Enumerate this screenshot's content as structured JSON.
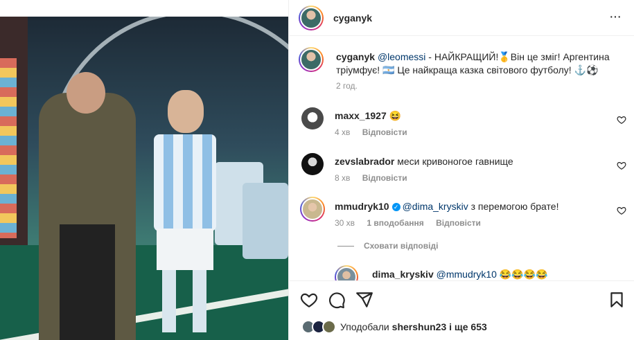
{
  "post": {
    "username": "cyganyk",
    "caption_user": "cyganyk",
    "caption_mention": "@leomessi",
    "caption_text_1": " - НАЙКРАЩИЙ!🥇Він це зміг! Аргентина",
    "caption_text_2": "тріумфує! 🇦🇷 Це найкраща казка світового футболу! ⚓⚽",
    "time_ago": "2 год."
  },
  "comments": [
    {
      "username": "maxx_1927",
      "text": "😆",
      "time": "4 хв",
      "reply_label": "Відповісти",
      "likes": ""
    },
    {
      "username": "zevslabrador",
      "text": "меси кривоногое гавнище",
      "time": "8 хв",
      "reply_label": "Відповісти",
      "likes": ""
    },
    {
      "username": "mmudryk10",
      "mention": "@dima_kryskiv",
      "text": " з перемогою брате!",
      "time": "30 хв",
      "likes": "1 вподобання",
      "reply_label": "Відповісти"
    }
  ],
  "hide_replies_label": "Сховати відповіді",
  "reply": {
    "username": "dima_kryskiv",
    "mention": "@mmudryk10",
    "text": " 😂😂😂😂"
  },
  "likes": {
    "prefix": "Уподобали",
    "user": "shershun23",
    "suffix": "і ще 653"
  },
  "colors": {
    "link": "#00376b",
    "muted": "#8e8e8e",
    "verified": "#0095f6"
  }
}
